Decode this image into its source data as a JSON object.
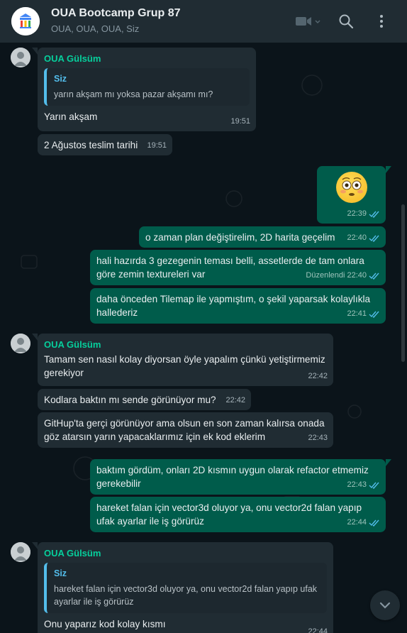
{
  "header": {
    "title": "OUA Bootcamp Grup 87",
    "subtitle": "OUA, OUA, OUA, Siz",
    "icons": [
      "video-call-icon",
      "search-icon",
      "menu-icon"
    ]
  },
  "colors": {
    "incoming": "#202c33",
    "outgoing": "#005c4b",
    "sender": "#06cf9c",
    "quote_author": "#53bdeb",
    "read_ticks": "#53bdeb"
  },
  "messages": [
    {
      "sender": "OUA Gülsüm",
      "quote_author": "Siz",
      "quote_text": "yarın akşam mı yoksa pazar akşamı mı?",
      "text": "Yarın akşam",
      "time": "19:51"
    },
    {
      "text": "2 Ağustos teslim tarihi",
      "time": "19:51"
    },
    {
      "time": "22:39"
    },
    {
      "text": "o zaman plan değiştirelim, 2D harita geçelim",
      "time": "22:40"
    },
    {
      "text": "hali hazırda 3 gezegenin teması belli, assetlerde de tam onlara göre zemin textureleri var",
      "edited": "Düzenlendi",
      "time": "22:40"
    },
    {
      "text": "daha önceden Tilemap ile yapmıştım, o şekil yaparsak kolaylıkla hallederiz",
      "time": "22:41"
    },
    {
      "sender": "OUA Gülsüm",
      "text": "Tamam sen nasıl kolay diyorsan öyle yapalım çünkü yetiştirmemiz gerekiyor",
      "time": "22:42"
    },
    {
      "text": "Kodlara baktın mı sende görünüyor mu?",
      "time": "22:42"
    },
    {
      "text": "GitHup'ta gerçi görünüyor ama olsun en son zaman kalırsa onada göz atarsın yarın yapacaklarımız için ek kod eklerim",
      "time": "22:43"
    },
    {
      "text": "baktım gördüm, onları 2D kısmın uygun olarak refactor etmemiz gerekebilir",
      "time": "22:43"
    },
    {
      "text": "hareket falan için vector3d oluyor ya, onu vector2d falan yapıp ufak ayarlar ile iş görürüz",
      "time": "22:44"
    },
    {
      "sender": "OUA Gülsüm",
      "quote_author": "Siz",
      "quote_text": "hareket falan için vector3d oluyor ya, onu vector2d falan yapıp ufak ayarlar ile iş görürüz",
      "text": "Onu yaparız kod kolay kısmı",
      "time": "22:44"
    }
  ]
}
